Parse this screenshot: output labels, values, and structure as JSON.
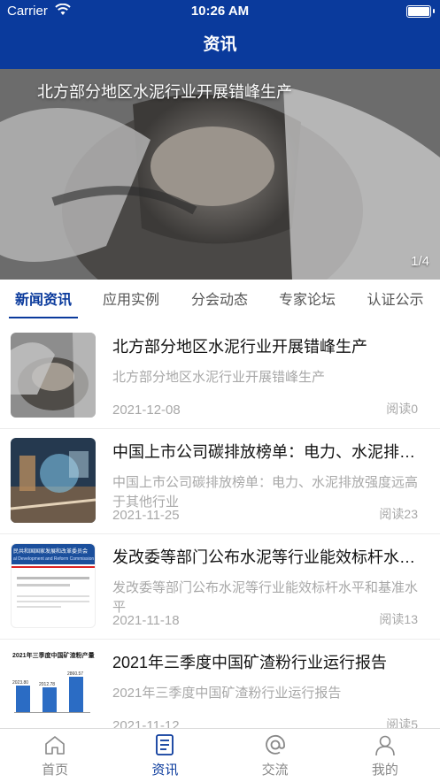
{
  "status_bar": {
    "carrier": "Carrier",
    "time": "10:26 AM"
  },
  "nav": {
    "title": "资讯"
  },
  "banner": {
    "title": "北方部分地区水泥行业开展错峰生产",
    "pager": "1/4"
  },
  "tabs": [
    {
      "label": "新闻资讯",
      "active": true
    },
    {
      "label": "应用实例"
    },
    {
      "label": "分会动态"
    },
    {
      "label": "专家论坛"
    },
    {
      "label": "认证公示"
    }
  ],
  "news": [
    {
      "title": "北方部分地区水泥行业开展错峰生产",
      "summary": "北方部分地区水泥行业开展错峰生产",
      "date": "2021-12-08",
      "reads": "阅读0"
    },
    {
      "title": "中国上市公司碳排放榜单：电力、水泥排放强度远高于其他行业",
      "summary": "中国上市公司碳排放榜单：电力、水泥排放强度远高于其他行业",
      "date": "2021-11-25",
      "reads": "阅读23"
    },
    {
      "title": "发改委等部门公布水泥等行业能效标杆水平和基准水平",
      "summary": "发改委等部门公布水泥等行业能效标杆水平和基准水平",
      "date": "2021-11-18",
      "reads": "阅读13",
      "thumb_header": "民共和国国家发展和改革委员会",
      "thumb_subheader": "al Development and Reform Commission"
    },
    {
      "title": "2021年三季度中国矿渣粉行业运行报告",
      "summary": "2021年三季度中国矿渣粉行业运行报告",
      "date": "2021-11-12",
      "reads": "阅读5",
      "thumb_chart_title": "2021年三季度中国矿渣粉产量",
      "thumb_chart_values": [
        "2023.80",
        "2012.78",
        "2860.57"
      ]
    }
  ],
  "tab_bar": [
    {
      "label": "首页",
      "icon": "home-icon"
    },
    {
      "label": "资讯",
      "icon": "news-icon",
      "active": true
    },
    {
      "label": "交流",
      "icon": "at-icon"
    },
    {
      "label": "我的",
      "icon": "person-icon"
    }
  ],
  "colors": {
    "brand": "#0a3a9c",
    "muted_text": "#a8a8a8"
  }
}
